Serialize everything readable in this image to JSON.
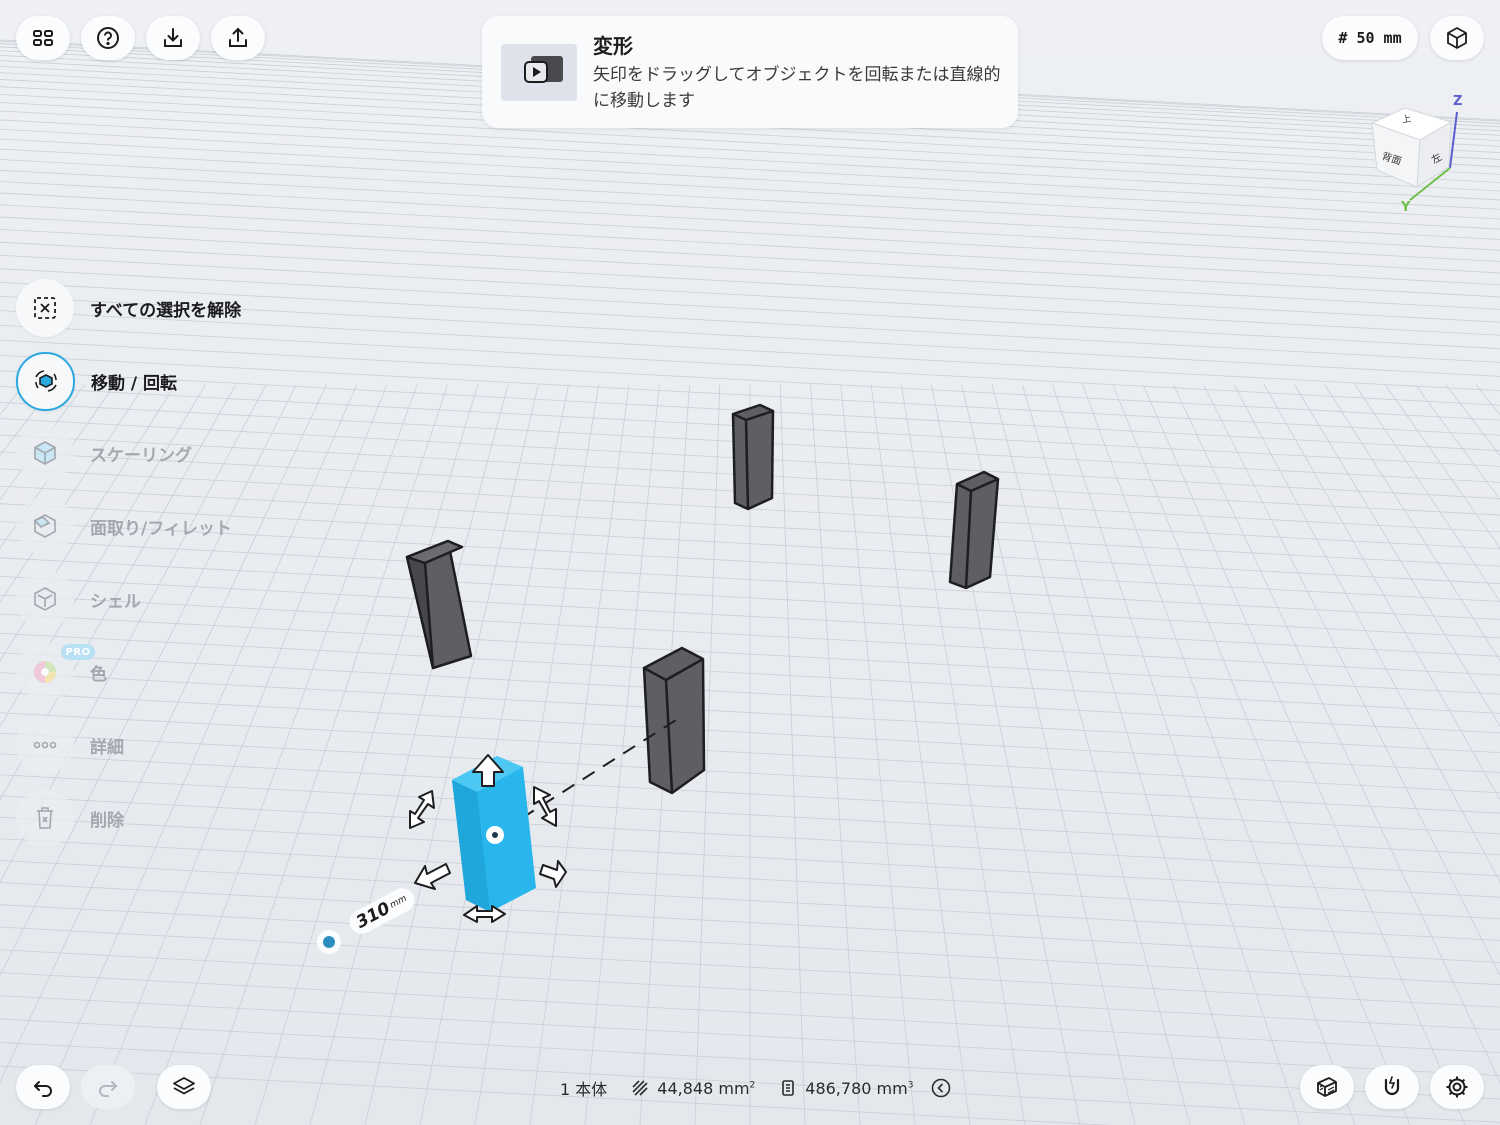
{
  "hint": {
    "title": "変形",
    "body": "矢印をドラッグしてオブジェクトを回転または直線的に移動します"
  },
  "grid_size": "# 50 mm",
  "view_cube": {
    "top": "上",
    "front": "背面",
    "side": "左",
    "axis_z": "Z",
    "axis_y": "Y"
  },
  "tools": [
    {
      "label": "すべての選択を解除",
      "state": "enabled"
    },
    {
      "label": "移動 / 回転",
      "state": "active"
    },
    {
      "label": "スケーリング",
      "state": "disabled"
    },
    {
      "label": "面取り/フィレット",
      "state": "disabled"
    },
    {
      "label": "シェル",
      "state": "disabled"
    },
    {
      "label": "色",
      "state": "disabled",
      "badge": "PRO"
    },
    {
      "label": "詳細",
      "state": "disabled"
    },
    {
      "label": "削除",
      "state": "disabled"
    }
  ],
  "dimension": {
    "value": "310",
    "unit": "mm"
  },
  "status": {
    "bodies": "1 本体",
    "area_value": "44,848 mm",
    "area_exp": "2",
    "volume_value": "486,780 mm",
    "volume_exp": "3"
  },
  "colors": {
    "accent": "#2aa9e0",
    "selected_body": "#29b6ec",
    "body": "#5b5b5f",
    "background": "#e9ecf0"
  }
}
